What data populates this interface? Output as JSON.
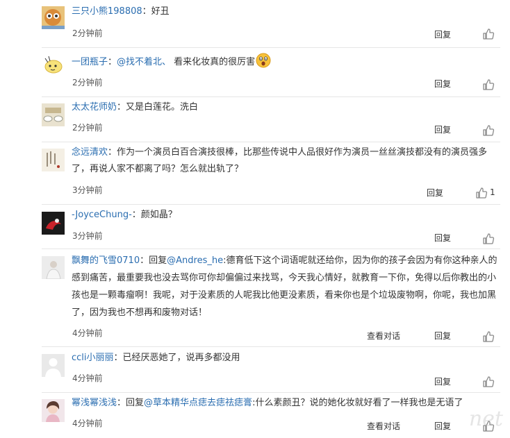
{
  "comments": [
    {
      "user": "三只小熊198808",
      "sep": "：",
      "text": "好丑",
      "time": "2分钟前",
      "reply": "回复"
    },
    {
      "user": "一团瓶子",
      "sep": "：",
      "mention": "@找不着北、",
      "text": "  看来化妆真的很厉害",
      "time": "2分钟前",
      "reply": "回复",
      "emoji": "shocked-face-icon"
    },
    {
      "user": "太太花师奶",
      "sep": "：",
      "text": "又是白莲花。洗白",
      "time": "2分钟前",
      "reply": "回复"
    },
    {
      "user": "念远清欢",
      "sep": "：",
      "text1": "作为一个演员白百合演技很棒，比那些传说中人品很好作为演员一丝丝演技都没有的演员强多",
      "text2": "了，再说人家不都离了吗？怎么就出轨了？",
      "time": "3分钟前",
      "reply": "回复",
      "likes": "1"
    },
    {
      "user": "-JoyceChung-",
      "sep": "：",
      "text": "颜如晶？",
      "time": "3分钟前",
      "reply": "回复"
    },
    {
      "user": "飘舞的飞雪0710",
      "sep": "：",
      "reply_prefix": "回复",
      "mention": "@Andres_he",
      "text1": ":德育低下这个词语呢就还给你，因为你的孩子会因为有你这种亲人的",
      "text2": "感到痛苦，最重要我也没去骂你可你却偏偏过来找骂，今天我心情好，就教育一下你，免得以后你教出的小",
      "text3": "孩也是一颗毒瘤啊！我呢，对于没素质的人呢我比他更没素质，看来你也是个垃圾废物啊，你呢，我也加黑",
      "text4": "了，因为我也不想再和废物对话！",
      "time": "4分钟前",
      "view": "查看对话",
      "reply": "回复"
    },
    {
      "user": "ccli小丽丽",
      "sep": "：",
      "text": "已经厌恶她了，说再多都没用",
      "time": "4分钟前",
      "reply": "回复"
    },
    {
      "user": "幂浅幂浅浅",
      "sep": "：",
      "reply_prefix": "回复",
      "mention": "@草本精华点痣去痣祛痣膏",
      "text": ":什么素颜丑？说的她化妆就好看了一样我也是无语了",
      "time": "4分钟前",
      "view": "查看对话",
      "reply": "回复"
    }
  ],
  "watermark": "net",
  "colors": {
    "link": "#2a6db0",
    "divider": "#e6e6e6"
  }
}
